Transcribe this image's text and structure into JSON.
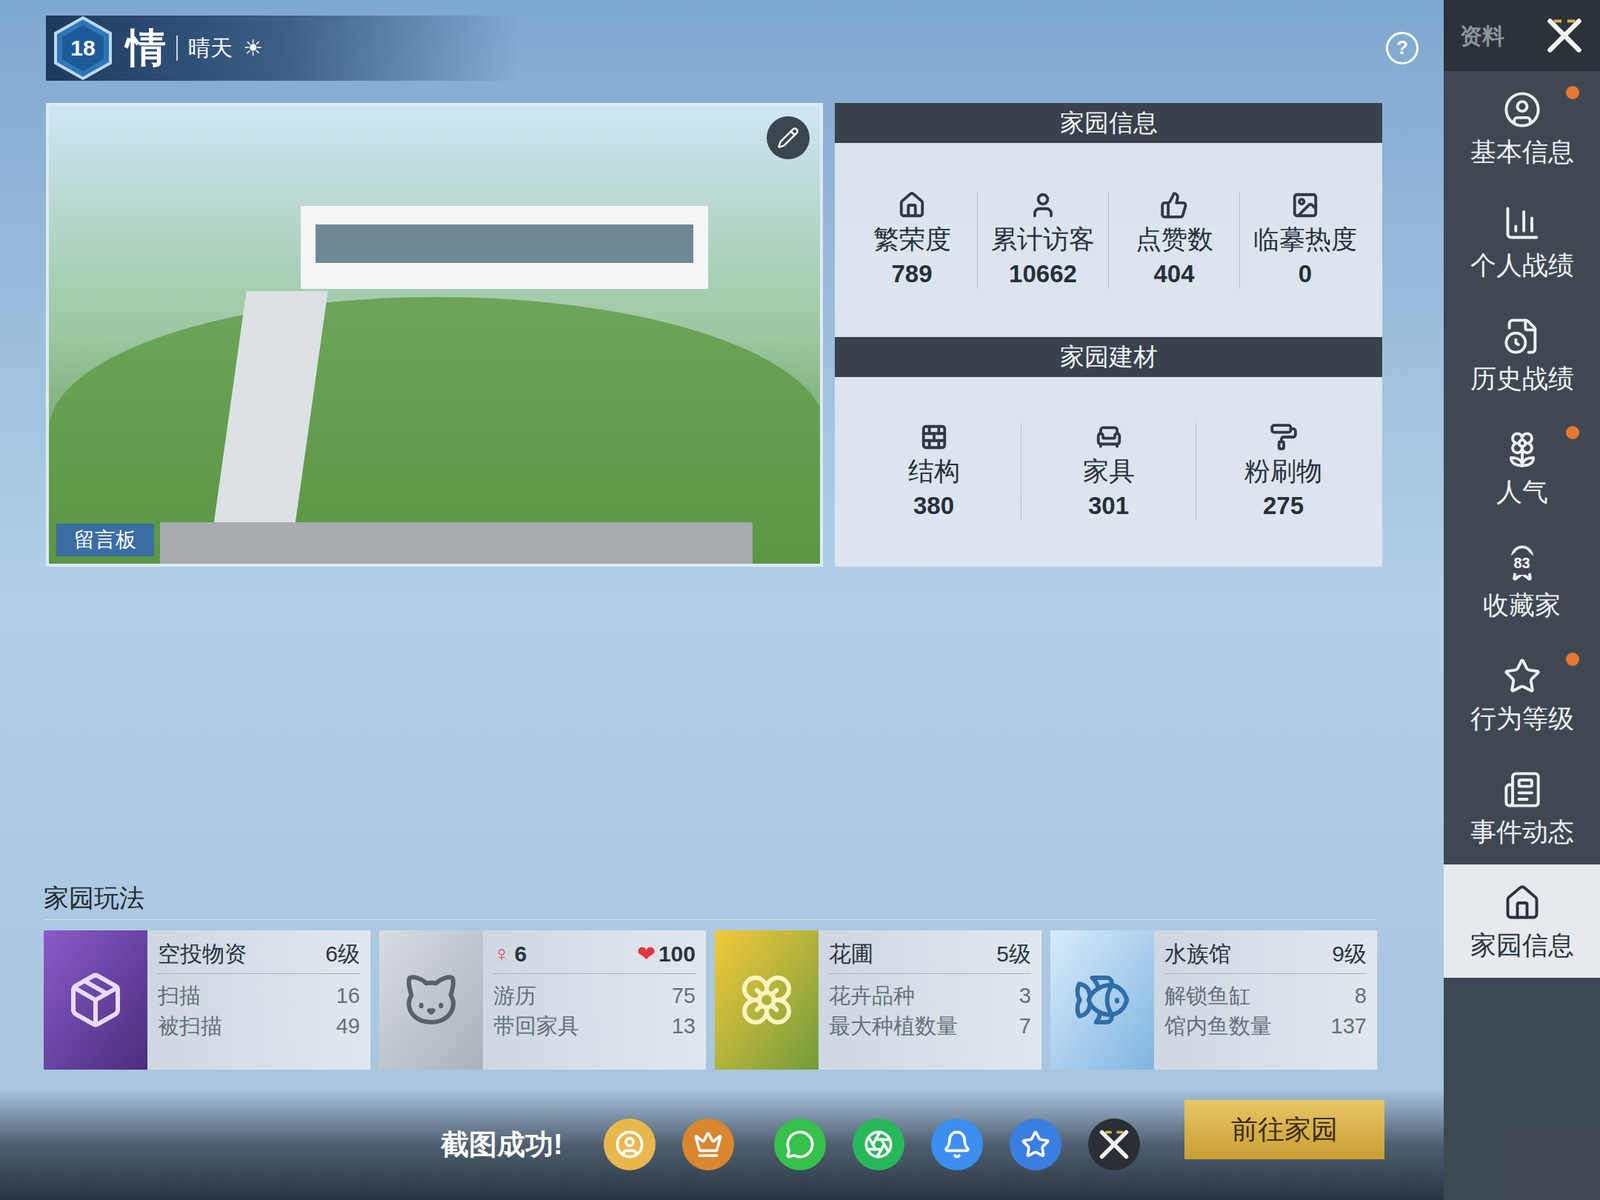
{
  "header": {
    "level": "18",
    "name": "情",
    "weather": "晴天",
    "weather_icon": "☀"
  },
  "help": "?",
  "preview": {
    "message_board": "留言板"
  },
  "home_info": {
    "title": "家园信息",
    "stats": [
      {
        "label": "繁荣度",
        "value": "789",
        "kind": "prosperity"
      },
      {
        "label": "累计访客",
        "value": "10662",
        "kind": "visitors"
      },
      {
        "label": "点赞数",
        "value": "404",
        "kind": "likes"
      },
      {
        "label": "临摹热度",
        "value": "0",
        "kind": "copy"
      }
    ]
  },
  "materials": {
    "title": "家园建材",
    "stats": [
      {
        "label": "结构",
        "value": "380",
        "kind": "structure"
      },
      {
        "label": "家具",
        "value": "301",
        "kind": "furniture"
      },
      {
        "label": "粉刷物",
        "value": "275",
        "kind": "paint"
      }
    ]
  },
  "play": {
    "title": "家园玩法",
    "cards": [
      {
        "kind": "level",
        "icon": "airdrop",
        "title": "空投物资",
        "level": "6级",
        "rows": [
          {
            "label": "扫描",
            "value": "16"
          },
          {
            "label": "被扫描",
            "value": "49"
          }
        ]
      },
      {
        "kind": "pet",
        "icon": "cat",
        "gender": "♀",
        "gender_value": "6",
        "heart": "❤",
        "heart_value": "100",
        "rows": [
          {
            "label": "游历",
            "value": "75"
          },
          {
            "label": "带回家具",
            "value": "13"
          }
        ]
      },
      {
        "kind": "level",
        "icon": "flower",
        "title": "花圃",
        "level": "5级",
        "rows": [
          {
            "label": "花卉品种",
            "value": "3"
          },
          {
            "label": "最大种植数量",
            "value": "7"
          }
        ]
      },
      {
        "kind": "level",
        "icon": "fish",
        "title": "水族馆",
        "level": "9级",
        "rows": [
          {
            "label": "解锁鱼缸",
            "value": "8"
          },
          {
            "label": "馆内鱼数量",
            "value": "137"
          }
        ]
      }
    ]
  },
  "bottom": {
    "toast": "截图成功!",
    "shares": [
      {
        "kind": "profile",
        "color": "#e9b84c"
      },
      {
        "kind": "game",
        "color": "#d9862f"
      },
      {
        "kind": "wechat",
        "color": "#35c14a"
      },
      {
        "kind": "moments",
        "color": "#27b85a"
      },
      {
        "kind": "qq",
        "color": "#3c8ff0"
      },
      {
        "kind": "qzone",
        "color": "#3a7ee0"
      },
      {
        "kind": "x",
        "color": "#2a2f36"
      }
    ],
    "go_button": "前往家园"
  },
  "sidebar": {
    "tab": "资料",
    "items": [
      {
        "label": "基本信息",
        "icon": "basic",
        "selected": false,
        "dot": true
      },
      {
        "label": "个人战绩",
        "icon": "record",
        "selected": false,
        "dot": false
      },
      {
        "label": "历史战绩",
        "icon": "history",
        "selected": false,
        "dot": false
      },
      {
        "label": "人气",
        "icon": "popularity",
        "selected": false,
        "dot": true
      },
      {
        "label": "收藏家",
        "icon": "collector",
        "selected": false,
        "dot": false,
        "badge": "83"
      },
      {
        "label": "行为等级",
        "icon": "behavior",
        "selected": false,
        "dot": true
      },
      {
        "label": "事件动态",
        "icon": "events",
        "selected": false,
        "dot": false
      },
      {
        "label": "家园信息",
        "icon": "home",
        "selected": true,
        "dot": false
      }
    ]
  }
}
